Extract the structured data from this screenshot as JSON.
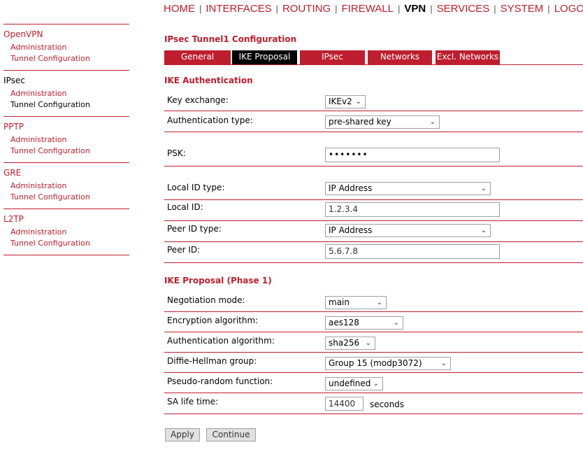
{
  "topnav": {
    "items": [
      "HOME",
      "INTERFACES",
      "ROUTING",
      "FIREWALL",
      "VPN",
      "SERVICES",
      "SYSTEM",
      "LOGOUT"
    ],
    "separator": "|",
    "active": "VPN"
  },
  "sidebar": {
    "groups": [
      {
        "title": "OpenVPN",
        "items": [
          "Administration",
          "Tunnel Configuration"
        ]
      },
      {
        "title": "IPsec",
        "items": [
          "Administration",
          "Tunnel Configuration"
        ]
      },
      {
        "title": "PPTP",
        "items": [
          "Administration",
          "Tunnel Configuration"
        ]
      },
      {
        "title": "GRE",
        "items": [
          "Administration",
          "Tunnel Configuration"
        ]
      },
      {
        "title": "L2TP",
        "items": [
          "Administration",
          "Tunnel Configuration"
        ]
      }
    ]
  },
  "page": {
    "title": "IPsec Tunnel1 Configuration",
    "tabs": [
      "General",
      "IKE Proposal",
      "IPsec",
      "Networks",
      "Excl. Networks"
    ],
    "active_tab": "IKE Proposal"
  },
  "ike_auth": {
    "section_title": "IKE Authentication",
    "key_exchange_label": "Key exchange:",
    "key_exchange_value": "IKEv2",
    "auth_type_label": "Authentication type:",
    "auth_type_value": "pre-shared key",
    "psk_label": "PSK:",
    "psk_value": "•••••••",
    "local_id_type_label": "Local ID type:",
    "local_id_type_value": "IP Address",
    "local_id_label": "Local ID:",
    "local_id_value": "1.2.3.4",
    "peer_id_type_label": "Peer ID type:",
    "peer_id_type_value": "IP Address",
    "peer_id_label": "Peer ID:",
    "peer_id_value": "5.6.7.8"
  },
  "ike_phase1": {
    "section_title": "IKE Proposal (Phase 1)",
    "negotiation_label": "Negotiation mode:",
    "negotiation_value": "main",
    "encryption_label": "Encryption algorithm:",
    "encryption_value": "aes128",
    "authentication_label": "Authentication algorithm:",
    "authentication_value": "sha256",
    "dh_label": "Diffie-Hellman group:",
    "dh_value": "Group 15 (modp3072)",
    "prf_label": "Pseudo-random function:",
    "prf_value": "undefined",
    "lifetime_label": "SA life time:",
    "lifetime_value": "14400",
    "lifetime_unit": "seconds"
  },
  "buttons": {
    "apply": "Apply",
    "continue": "Continue"
  },
  "colors": {
    "accent": "#be1e2d",
    "active_tab": "#000000"
  },
  "icons": {
    "dropdown": "chevron-down-icon"
  }
}
